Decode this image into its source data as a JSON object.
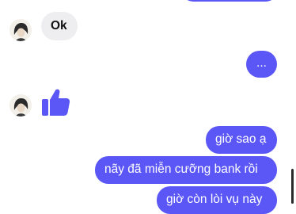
{
  "conversation": {
    "messages": [
      {
        "from": "contact",
        "type": "text",
        "text": "Ok"
      },
      {
        "from": "me",
        "type": "text",
        "text": "..."
      },
      {
        "from": "contact",
        "type": "like",
        "icon": "thumbs-up-icon"
      },
      {
        "from": "me",
        "type": "text",
        "text": "giờ sao ạ"
      },
      {
        "from": "me",
        "type": "text",
        "text": "nãy đã miễn cưỡng bank rồi"
      },
      {
        "from": "me",
        "type": "text",
        "text": "giờ còn lòi vụ này"
      }
    ]
  },
  "colors": {
    "outgoing_bubble": "#5b57f6",
    "incoming_bubble": "#eeeef0",
    "like_icon": "#5b57f6"
  }
}
